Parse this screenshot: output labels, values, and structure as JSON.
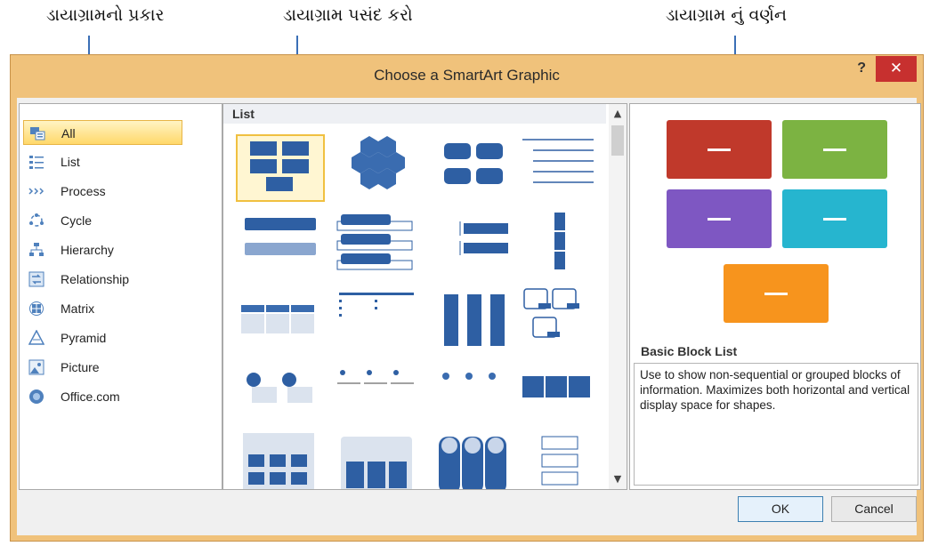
{
  "annotations": {
    "type": "ડાયાગ્રામનો પ્રકાર",
    "select": "ડાયાગ્રામ પસંદ કરો",
    "description": "ડાયાગ્રામ નું વર્ણન"
  },
  "dialog": {
    "title": "Choose a SmartArt Graphic",
    "help": "?",
    "close": "✕"
  },
  "categories": [
    {
      "label": "All",
      "icon": "all-icon"
    },
    {
      "label": "List",
      "icon": "list-icon"
    },
    {
      "label": "Process",
      "icon": "process-icon"
    },
    {
      "label": "Cycle",
      "icon": "cycle-icon"
    },
    {
      "label": "Hierarchy",
      "icon": "hierarchy-icon"
    },
    {
      "label": "Relationship",
      "icon": "relationship-icon"
    },
    {
      "label": "Matrix",
      "icon": "matrix-icon"
    },
    {
      "label": "Pyramid",
      "icon": "pyramid-icon"
    },
    {
      "label": "Picture",
      "icon": "picture-icon"
    },
    {
      "label": "Office.com",
      "icon": "office-com-icon"
    }
  ],
  "gallery": {
    "header": "List",
    "selected_index": 0
  },
  "preview": {
    "name": "Basic Block List",
    "description": "Use to show non-sequential or grouped blocks of information. Maximizes both horizontal and vertical display space for shapes.",
    "colors": [
      "#c0392b",
      "#7cb342",
      "#7e57c2",
      "#26b5cf",
      "#f7941d"
    ]
  },
  "buttons": {
    "ok": "OK",
    "cancel": "Cancel"
  },
  "colors": {
    "accent_blue": "#4f81bd",
    "selection": "#ffd86a",
    "close_red": "#c7302f"
  }
}
